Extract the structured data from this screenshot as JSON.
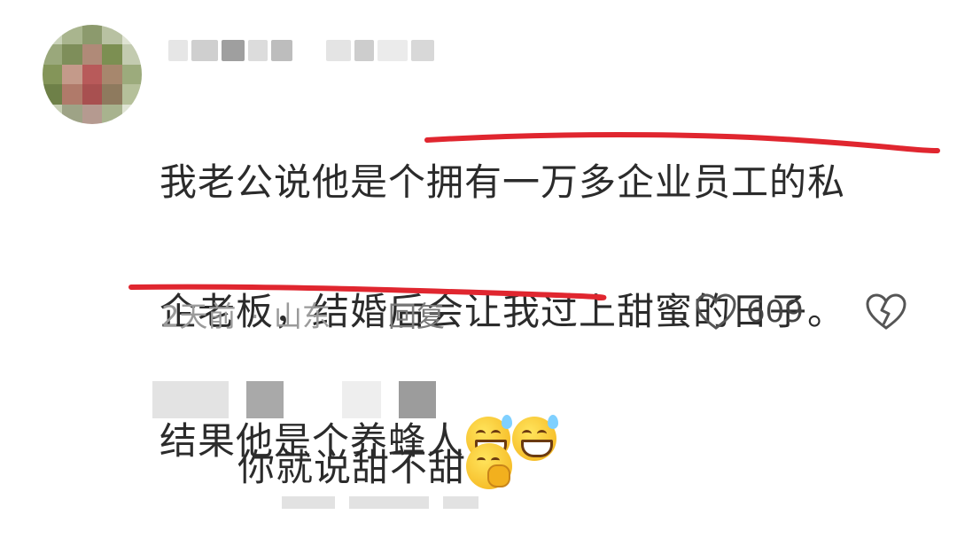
{
  "comment": {
    "lines": [
      "我老公说他是个拥有一万多企业员工的私",
      "企老板，结婚后会让我过上甜蜜的日子。",
      "结果他是个养蜂人"
    ],
    "emoji": [
      "grinning-sweat-emoji",
      "grinning-sweat-emoji"
    ],
    "time": "2天前",
    "separator": "·",
    "location": "山东",
    "reply_label": "回复",
    "likes": "609",
    "highlight_color": "#e0262f"
  },
  "reply": {
    "text": "你就说甜不甜",
    "emoji": "shushing-face-emoji"
  }
}
